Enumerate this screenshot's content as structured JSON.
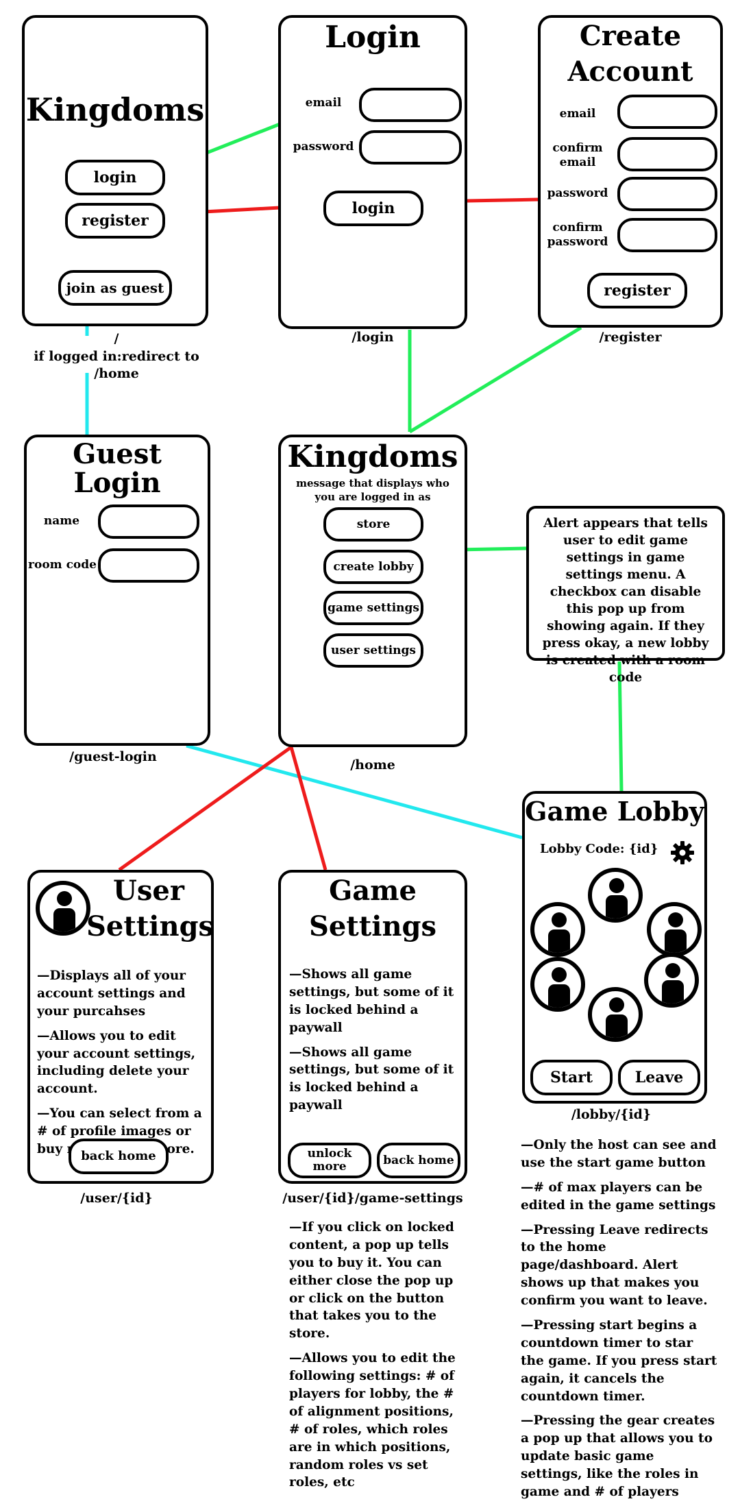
{
  "colors": {
    "green": "#22ee5a",
    "red": "#ee1c1c",
    "cyan": "#22e8ee"
  },
  "landing": {
    "title": "Kingdoms",
    "login_button": "login",
    "register_button": "register",
    "guest_button": "join as guest",
    "route": "/",
    "route_note": "if logged in:redirect to /home"
  },
  "login": {
    "title": "Login",
    "email_label": "email",
    "password_label": "password",
    "login_button": "login",
    "route": "/login"
  },
  "register": {
    "title_line1": "Create",
    "title_line2": "Account",
    "email_label": "email",
    "confirm_email_label_1": "confirm",
    "confirm_email_label_2": "email",
    "password_label": "password",
    "confirm_password_label_1": "confirm",
    "confirm_password_label_2": "password",
    "register_button": "register",
    "route": "/register"
  },
  "guest_login": {
    "title": "Guest Login",
    "name_label": "name",
    "room_code_label": "room code",
    "route": "/guest-login"
  },
  "home": {
    "title": "Kingdoms",
    "subtitle_line1": "message that displays who",
    "subtitle_line2": "you are logged in as",
    "store_button": "store",
    "create_lobby_button": "create lobby",
    "game_settings_button": "game settings",
    "user_settings_button": "user settings",
    "route": "/home"
  },
  "alert_note": "Alert appears that tells user to edit game settings in game settings menu. A checkbox can disable this pop up from showing again. If they press okay, a new lobby is created with a room code",
  "user_settings": {
    "title_line1": "User",
    "title_line2": "Settings",
    "desc": [
      "—Displays all of your account settings and your purcahses",
      "—Allows you to edit your account settings, including delete your account.",
      "—You can select from a # of profile images or buy more in the store."
    ],
    "back_button": "back home",
    "route": "/user/{id}"
  },
  "game_settings": {
    "title_line1": "Game",
    "title_line2": "Settings",
    "desc": [
      "—Shows all game settings, but some of it is locked behind a paywall",
      "—Shows all game settings, but some of it is locked behind a paywall"
    ],
    "unlock_button": "unlock more",
    "back_button": "back home",
    "route": "/user/{id}/game-settings",
    "notes": [
      "—If you click on locked content, a pop up tells you to buy it. You can either close the pop up or click on the button that takes you to the store.",
      "—Allows you to edit the following settings: # of players for lobby, the # of alignment positions, # of roles, which roles are in which positions, random roles vs set roles, etc"
    ]
  },
  "lobby": {
    "title": "Game Lobby",
    "code_label": "Lobby Code: {id}",
    "gear_icon": "gear-icon",
    "start_button": "Start",
    "leave_button": "Leave",
    "route": "/lobby/{id}",
    "notes": [
      "—Only the host can see and use the start game button",
      "—# of max players can be edited in the game settings",
      "—Pressing Leave redirects to the home page/dashboard. Alert shows up that makes you confirm you want to leave.",
      "—Pressing start begins a countdown timer to star the game. If you press start again, it cancels the countdown timer.",
      "—Pressing the gear creates a pop up that allows you to update basic game settings, like the roles in game and # of players"
    ]
  }
}
